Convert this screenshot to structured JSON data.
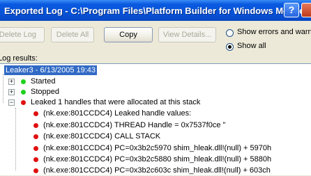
{
  "window": {
    "title": "Exported Log - C:\\Program Files\\Platform Builder for Windows Mobile\\",
    "help_label": "?"
  },
  "toolbar": {
    "delete_log": "Delete Log",
    "delete_all": "Delete All",
    "copy": "Copy",
    "view_details": "View Details..."
  },
  "filter": {
    "show_errors_label": "Show errors and warnings",
    "show_all_label": "Show all",
    "selected": "Show all"
  },
  "results_label": "Log results:",
  "tree": {
    "root": "Leaker3 - 6/13/2005 19:43",
    "items": [
      {
        "label": "Started",
        "status": "green"
      },
      {
        "label": "Stopped",
        "status": "green"
      },
      {
        "label": "Leaked 1 handles that were allocated at this stack",
        "status": "red"
      }
    ],
    "children": [
      "(nk.exe:801CCDC4) Leaked handle values:",
      "(nk.exe:801CCDC4) THREAD Handle = 0x7537f0ce \"",
      "(nk.exe:801CCDC4) CALL STACK",
      "(nk.exe:801CCDC4) PC=0x3b2c5970 shim_hleak.dll!(null) + 5970h",
      "(nk.exe:801CCDC4) PC=0x3b2c5880 shim_hleak.dll!(null) + 5880h",
      "(nk.exe:801CCDC4) PC=0x3b2c603c shim_hleak.dll!(null) + 603ch"
    ]
  },
  "colors": {
    "titlebar": "#0651d6",
    "selection": "#316ac5",
    "ok_dot": "#1fd11f",
    "error_dot": "#e01010"
  }
}
